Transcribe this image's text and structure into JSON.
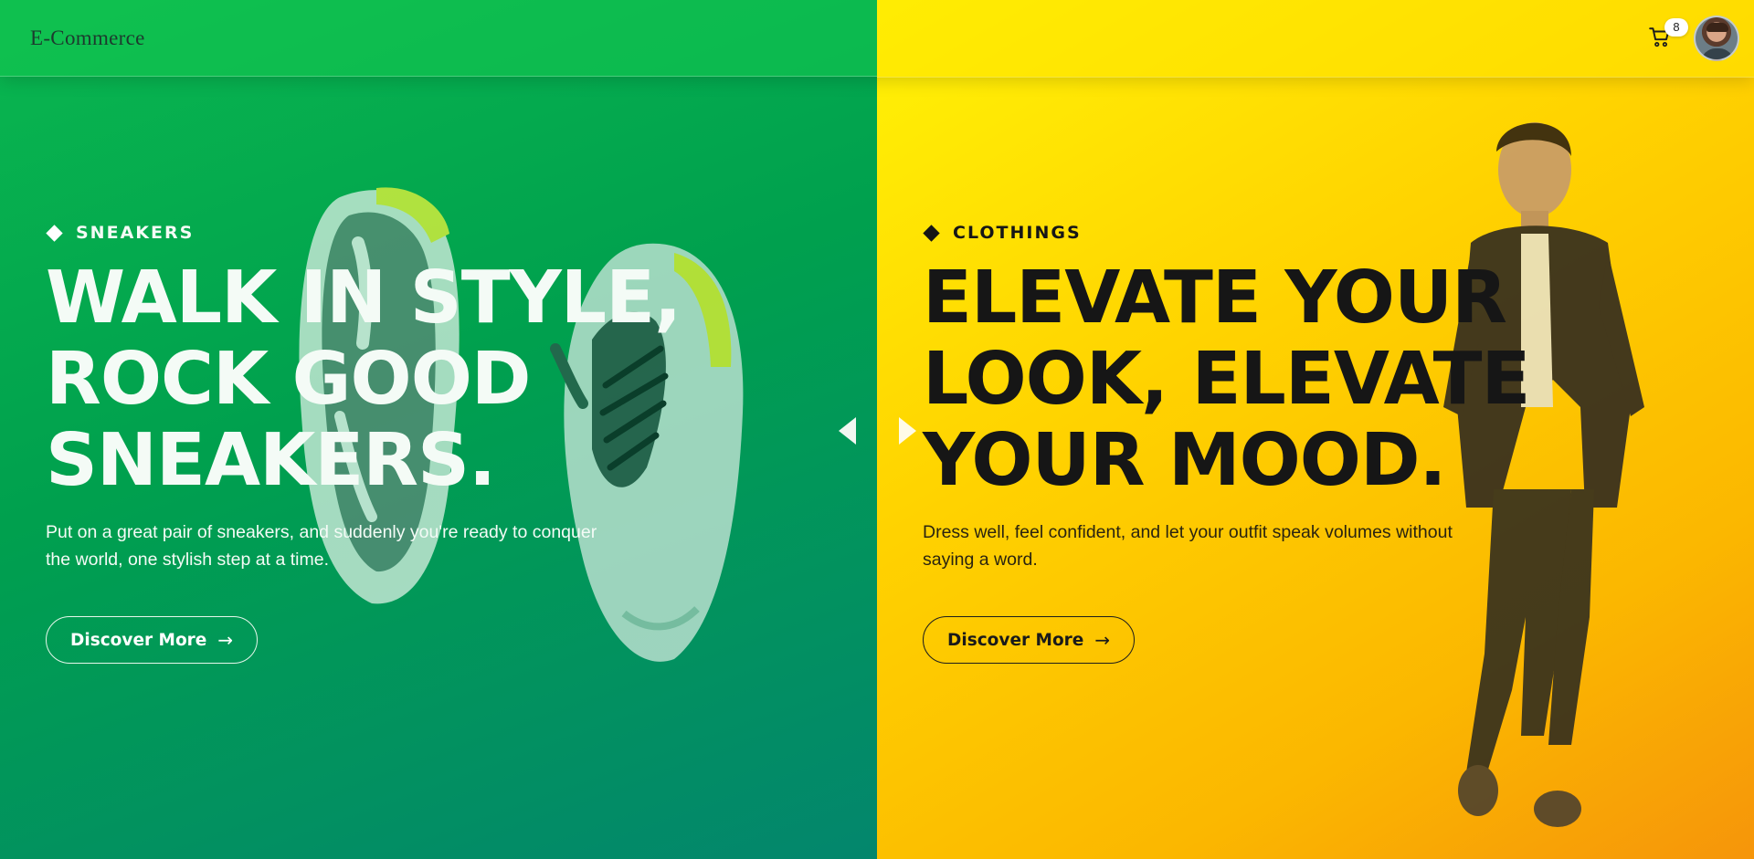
{
  "header": {
    "brand": "E-Commerce",
    "cart_count": "8",
    "cart_icon": "cart-icon",
    "avatar_icon": "user-avatar"
  },
  "slides": [
    {
      "category": "SNEAKERS",
      "headline": [
        "WALK IN STYLE,",
        "ROCK GOOD",
        "SNEAKERS."
      ],
      "description": [
        "Put on a great pair of sneakers, and suddenly you're ready to conquer",
        "the world, one stylish step at a time."
      ],
      "button_label": "Discover More",
      "accent": "#00a04e"
    },
    {
      "category": "CLOTHINGS",
      "headline": [
        "ELEVATE YOUR",
        "LOOK, ELEVATE",
        "YOUR MOOD."
      ],
      "description": [
        "Dress well, feel confident, and let your outfit speak volumes without",
        "saying a word."
      ],
      "button_label": "Discover More",
      "accent": "#ffd200"
    }
  ],
  "nav": {
    "prev_icon": "triangle-left-icon",
    "next_icon": "triangle-right-icon"
  }
}
